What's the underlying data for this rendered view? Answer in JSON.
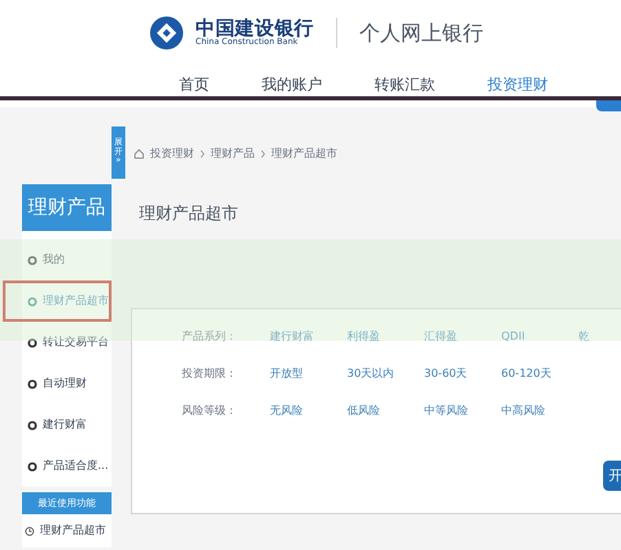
{
  "header": {
    "bank_name": "中国建设银行",
    "bank_name_en": "China Construction Bank",
    "site_title": "个人网上银行"
  },
  "nav": [
    {
      "label": "首页",
      "selected": false
    },
    {
      "label": "我的账户",
      "selected": false
    },
    {
      "label": "转账汇款",
      "selected": false
    },
    {
      "label": "投资理财",
      "selected": true
    }
  ],
  "side_toggle": {
    "label": "展开",
    "arrow": "»"
  },
  "breadcrumb": [
    "投资理财",
    "理财产品",
    "理财产品超市"
  ],
  "sidebar": {
    "title": "理财产品",
    "items": [
      {
        "label": "我的",
        "selected": false
      },
      {
        "label": "理财产品超市",
        "selected": true
      },
      {
        "label": "转让交易平台",
        "selected": false
      },
      {
        "label": "自动理财",
        "selected": false
      },
      {
        "label": "建行财富",
        "selected": false
      },
      {
        "label": "产品适合度...",
        "selected": false
      }
    ],
    "recent_title": "最近使用功能",
    "recent_items": [
      "理财产品超市"
    ]
  },
  "page_title": "理财产品超市",
  "filters": [
    {
      "label": "产品系列：",
      "options": [
        "建行财富",
        "利得盈",
        "汇得盈",
        "QDII",
        "乾"
      ]
    },
    {
      "label": "投资期限：",
      "options": [
        "开放型",
        "30天以内",
        "30-60天",
        "60-120天"
      ]
    },
    {
      "label": "风险等级：",
      "options": [
        "无风险",
        "低风险",
        "中等风险",
        "中高风险"
      ]
    }
  ],
  "search_button": "开"
}
